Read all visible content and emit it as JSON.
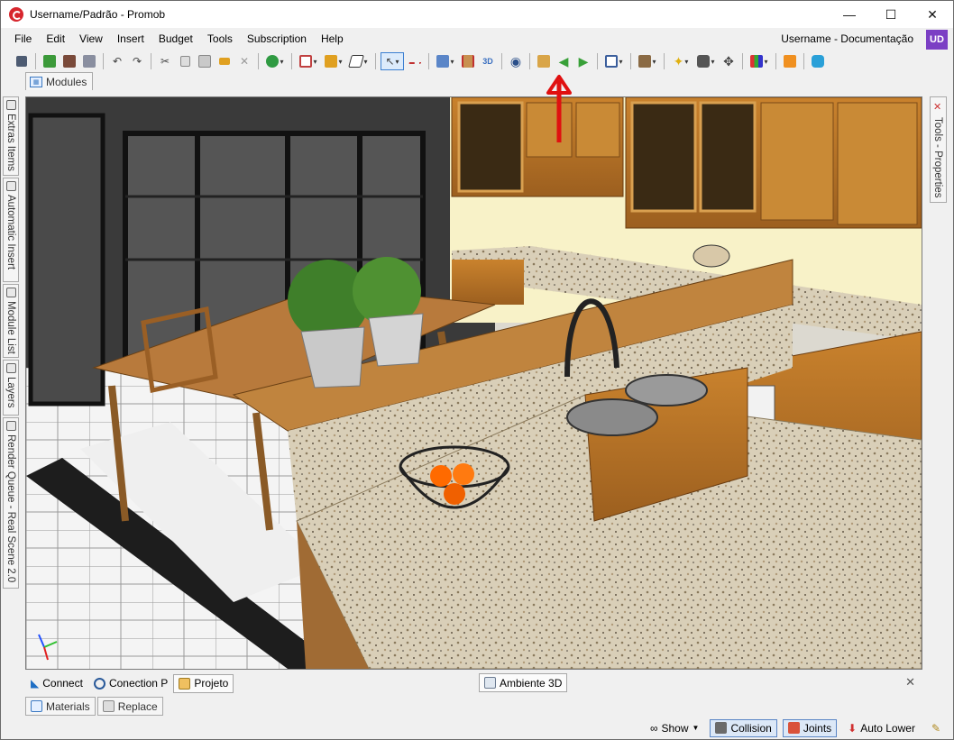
{
  "window": {
    "title": "Username/Padrão - Promob"
  },
  "menu": {
    "items": [
      "File",
      "Edit",
      "View",
      "Insert",
      "Budget",
      "Tools",
      "Subscription",
      "Help"
    ]
  },
  "user": {
    "label": "Username - Documentação",
    "initials": "UD",
    "color": "#7b3fc4"
  },
  "tabs": {
    "modules": "Modules",
    "left_panels": [
      "Extras Items",
      "Automatic Insert",
      "Module List",
      "Layers",
      "Render Queue - Real Scene 2.0"
    ],
    "right_panel": "Tools - Properties",
    "bottom": [
      "Connect",
      "Conection P",
      "Projeto"
    ],
    "bottom_selected": "Projeto",
    "viewport_tab": "Ambiente 3D",
    "bottom_secondary": [
      "Materials",
      "Replace"
    ]
  },
  "status": {
    "show": "Show",
    "collision": "Collision",
    "joints": "Joints",
    "auto_lower": "Auto Lower"
  },
  "annotation": {
    "arrow_color": "#e01010",
    "target": "3d-view-button"
  },
  "icons": {
    "toolbar": [
      "save-icon",
      "green-cart-icon",
      "print-icon",
      "print-preview-icon",
      "undo-icon",
      "redo-icon",
      "cut-icon",
      "copy-icon",
      "paste-icon",
      "hammer-icon",
      "delete-icon",
      "budget-dollar-icon",
      "frame-icon",
      "module-tree-icon",
      "shape-icon",
      "select-arrow-icon",
      "measure-icon",
      "layers-cube-icon",
      "dimension-icon",
      "3d-view-icon",
      "eye-icon",
      "move-icon",
      "arrow-left-icon",
      "arrow-right-icon",
      "camera-frame-icon",
      "box-icon",
      "light-bulb-icon",
      "camera-icon",
      "compass-icon",
      "color-palette-icon",
      "user-icon",
      "chat-icon"
    ]
  }
}
